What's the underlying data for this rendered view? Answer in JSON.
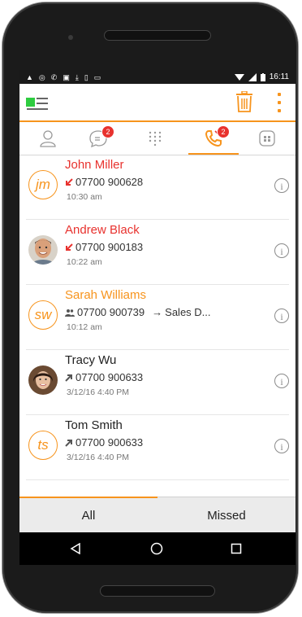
{
  "status_bar": {
    "time": "16:11"
  },
  "toolbar": {
    "menu_icon": "menu-icon",
    "delete_icon": "trash-icon",
    "more_icon": "more-vert-icon"
  },
  "tabs": [
    {
      "name": "contacts",
      "icon": "person-icon",
      "badge": ""
    },
    {
      "name": "messages",
      "icon": "chat-icon",
      "badge": "2"
    },
    {
      "name": "dialpad",
      "icon": "dialpad-icon",
      "badge": ""
    },
    {
      "name": "calls",
      "icon": "phone-missed-icon",
      "badge": "2",
      "active": true
    },
    {
      "name": "voicemail",
      "icon": "voicemail-icon",
      "badge": ""
    }
  ],
  "calls": [
    {
      "initials": "jm",
      "name": "John Miller",
      "name_color": "#e8322e",
      "call_type": "missed",
      "number": "07700 900628",
      "extra": "",
      "time": "10:30 am"
    },
    {
      "initials": "",
      "name": "Andrew Black",
      "name_color": "#e8322e",
      "call_type": "missed",
      "number": "07700 900183",
      "extra": "",
      "time": "10:22 am"
    },
    {
      "initials": "sw",
      "name": "Sarah Williams",
      "name_color": "#f7941d",
      "call_type": "group",
      "number": "07700 900739",
      "extra": "Sales D...",
      "time": "10:12 am"
    },
    {
      "initials": "",
      "name": "Tracy Wu",
      "name_color": "#222222",
      "call_type": "outgoing",
      "number": "07700 900633",
      "extra": "",
      "time": "3/12/16 4:40 PM"
    },
    {
      "initials": "ts",
      "name": "Tom Smith",
      "name_color": "#222222",
      "call_type": "outgoing",
      "number": "07700 900633",
      "extra": "",
      "time": "3/12/16 4:40 PM"
    }
  ],
  "filters": {
    "all": "All",
    "missed": "Missed"
  },
  "colors": {
    "accent": "#f7941d",
    "missed": "#e8322e",
    "badge": "#e8322e"
  }
}
